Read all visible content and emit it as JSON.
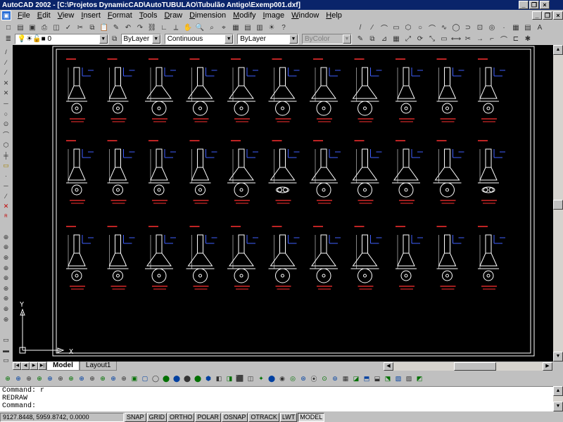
{
  "window": {
    "title": "AutoCAD 2002 - [C:\\Projetos DynamicCAD\\AutoTUBULÃO\\Tubulão Antigo\\Exemp001.dxf]",
    "controls": [
      "_",
      "❐",
      "×"
    ],
    "doc_controls": [
      "_",
      "❐",
      "×"
    ]
  },
  "menu": {
    "items": [
      "File",
      "Edit",
      "View",
      "Insert",
      "Format",
      "Tools",
      "Draw",
      "Dimension",
      "Modify",
      "Image",
      "Window",
      "Help"
    ]
  },
  "toolbar_standard": {
    "icons": [
      "new-icon",
      "open-icon",
      "save-icon",
      "print-icon",
      "preview-icon",
      "spell-icon",
      "cut-icon",
      "copy-icon",
      "paste-icon",
      "matchprop-icon",
      "undo-icon",
      "redo-icon",
      "hyperlink-icon",
      "ucs-icon",
      "tracking-icon",
      "pan-icon",
      "zoom-realtime-icon",
      "zoom-window-icon",
      "zoom-previous-icon",
      "adcenter-icon",
      "properties-icon",
      "dbconnect-icon",
      "today-icon",
      "help-icon"
    ],
    "glyphs": [
      "□",
      "▤",
      "▣",
      "⎙",
      "◫",
      "✓",
      "✂",
      "⧉",
      "📋",
      "✎",
      "↶",
      "↷",
      "⛓",
      "∟",
      "⟂",
      "✋",
      "🔍",
      "⌕",
      "⌖",
      "▦",
      "▤",
      "▥",
      "☀",
      "?"
    ]
  },
  "toolbar_draw_top": {
    "glyphs": [
      "/",
      "⁄",
      "⌒",
      "▭",
      "⬡",
      "○",
      "⌒",
      "∿",
      "◯",
      "⊃",
      "⊡",
      "◎",
      "·",
      "▦",
      "▤",
      "A"
    ]
  },
  "layers": {
    "layer_value": "0",
    "color_value": "ByLayer",
    "linetype_value": "Continuous",
    "lineweight_value": "ByLayer",
    "plotstyle_value": "ByColor"
  },
  "toolbar_modify_top": {
    "glyphs": [
      "✎",
      "⧉",
      "⊿",
      "▦",
      "⤢",
      "⟳",
      "⤡",
      "▭",
      "⟷",
      "✂",
      "→",
      "⌐",
      "⌒",
      "⊏",
      "✱"
    ]
  },
  "left_toolbar": {
    "glyphs": [
      "/",
      "⁄",
      "⁄",
      "✕",
      "✕",
      "─",
      "○",
      "⊙",
      "⌒",
      "⬡",
      "╪",
      "▭",
      "·",
      "─",
      "⁄",
      "✕",
      "ᴿ",
      "",
      "⊕",
      "⊕",
      "⊕",
      "⊕",
      "⊕",
      "⊕",
      "⊕",
      "⊕",
      "⊕",
      "",
      "▭",
      "▬",
      "▭"
    ]
  },
  "drawing": {
    "sheet_rows": 3,
    "sheet_cols": 11,
    "ucs_y": "Y",
    "ucs_x": "X"
  },
  "tabs": {
    "nav": [
      "|◀",
      "◀",
      "▶",
      "▶|"
    ],
    "items": [
      "Model",
      "Layout1"
    ]
  },
  "bottom_toolbar": {
    "glyphs": [
      "⊕",
      "⊕",
      "⊕",
      "⊕",
      "⊕",
      "⊕",
      "⊕",
      "⊕",
      "⊕",
      "⊕",
      "⊕",
      "⊕",
      "▣",
      "▢",
      "◯",
      "⬤",
      "⬤",
      "⬤",
      "⬤",
      "⬢",
      "◧",
      "◨",
      "⬛",
      "◫",
      "✦",
      "⬤",
      "◉",
      "◎",
      "⊛",
      "⦿",
      "⊙",
      "⊚",
      "▦",
      "◪",
      "⬒",
      "⬓",
      "⬔",
      "▧",
      "▨",
      "◩"
    ]
  },
  "command": {
    "lines": [
      "Command: r",
      "REDRAW",
      "Command:"
    ]
  },
  "status": {
    "coords": "9127.8448, 5959.8742, 0.0000",
    "buttons": [
      "SNAP",
      "GRID",
      "ORTHO",
      "POLAR",
      "OSNAP",
      "OTRACK",
      "LWT",
      "MODEL"
    ]
  }
}
